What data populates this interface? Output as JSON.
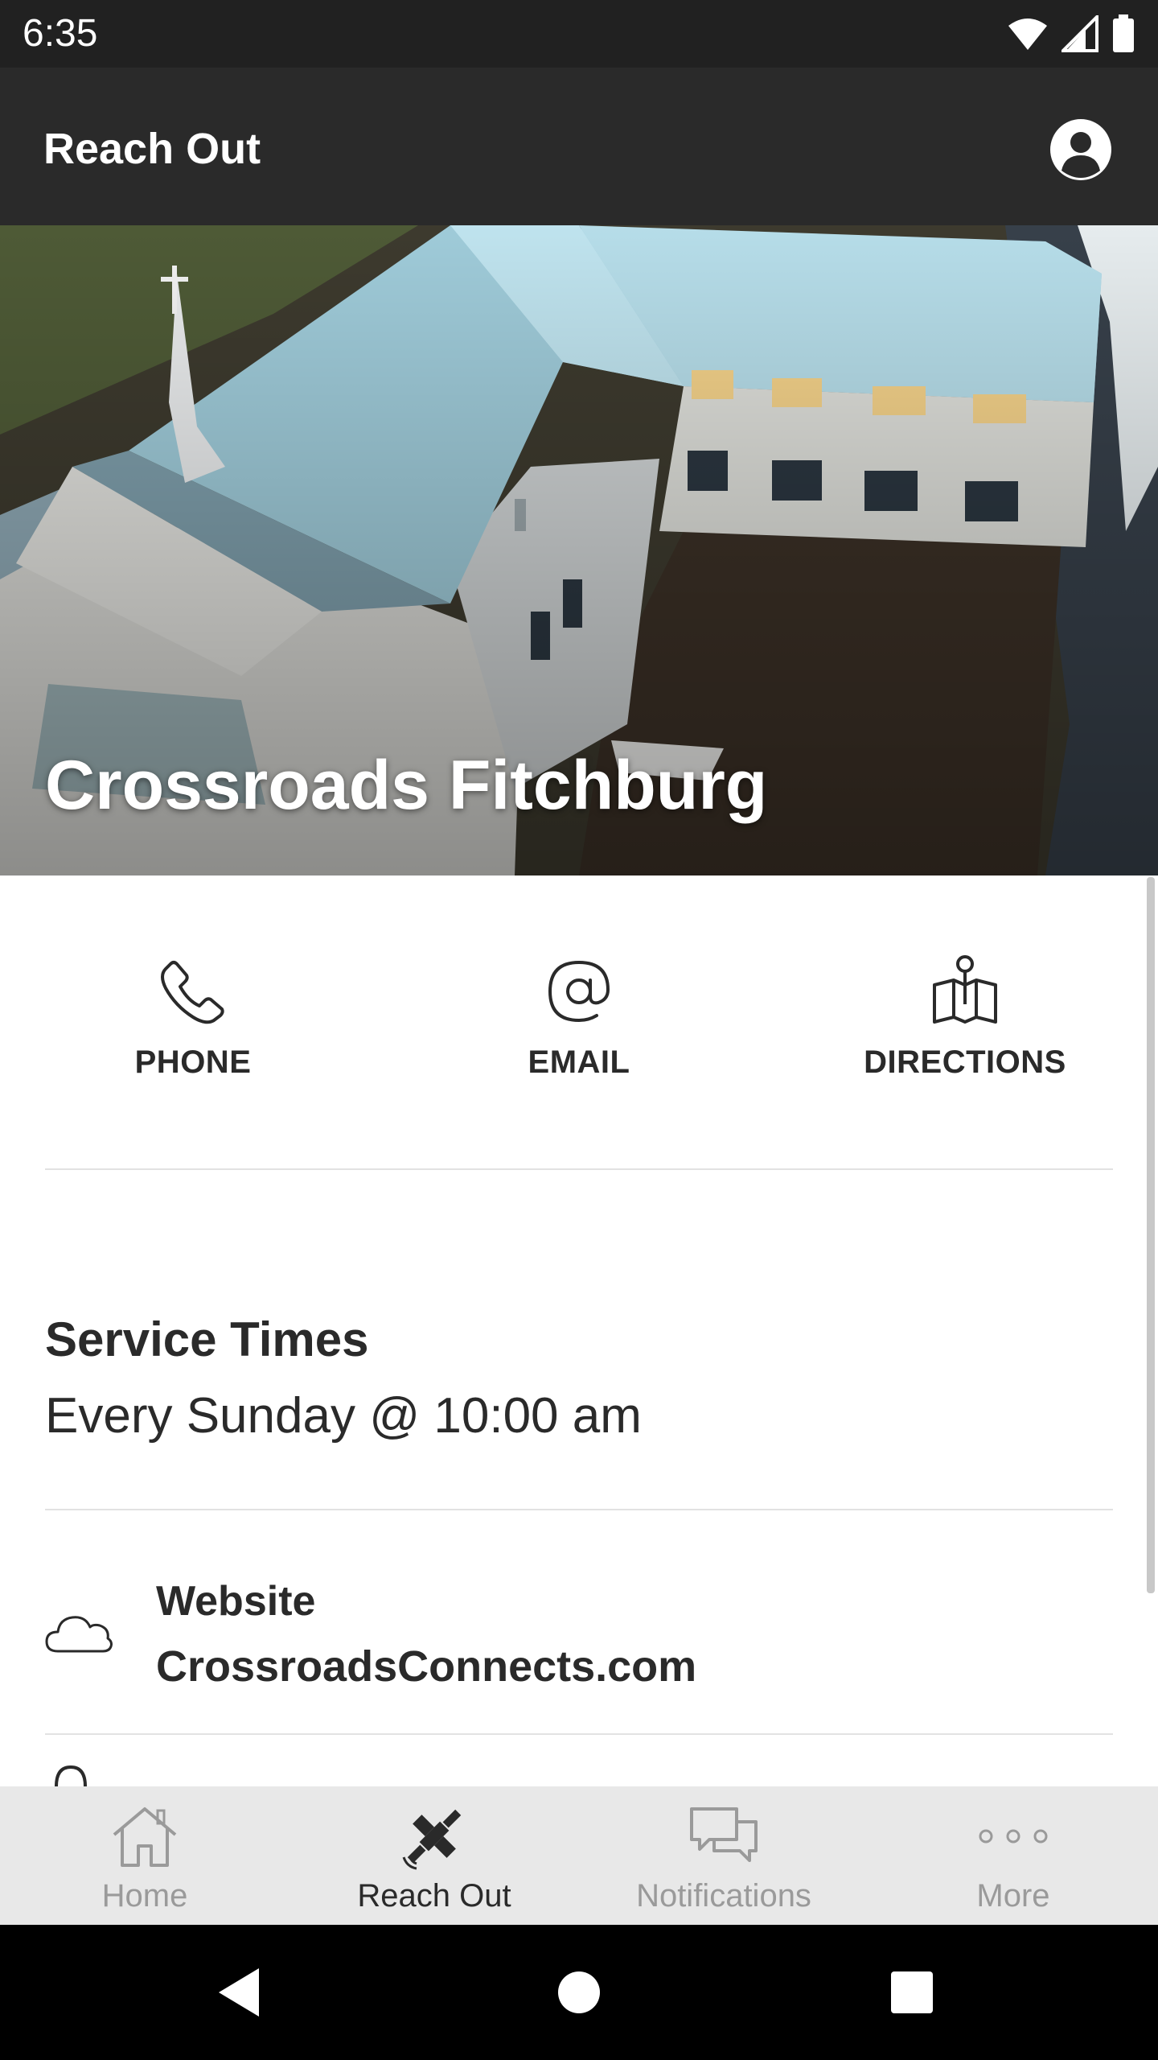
{
  "status_bar": {
    "time": "6:35"
  },
  "app_bar": {
    "title": "Reach Out"
  },
  "hero": {
    "title": "Crossroads Fitchburg"
  },
  "actions": [
    {
      "label": "PHONE",
      "icon": "phone-icon"
    },
    {
      "label": "EMAIL",
      "icon": "at-sign-icon"
    },
    {
      "label": "DIRECTIONS",
      "icon": "map-pin-icon"
    }
  ],
  "service": {
    "heading": "Service Times",
    "value": "Every Sunday @ 10:00 am"
  },
  "website": {
    "label": "Website",
    "value": "CrossroadsConnects.com",
    "icon": "cloud-icon"
  },
  "bottom_nav": {
    "items": [
      {
        "label": "Home",
        "icon": "home-icon"
      },
      {
        "label": "Reach Out",
        "icon": "satellite-icon",
        "active": true
      },
      {
        "label": "Notifications",
        "icon": "chat-bubbles-icon"
      },
      {
        "label": "More",
        "icon": "more-dots-icon"
      }
    ]
  },
  "colors": {
    "app_bar": "#2a2a2a",
    "status_bar": "#212121",
    "bottom_nav_bg": "#e8e8e8",
    "nav_inactive": "#9a9a9a",
    "nav_active": "#2a2a2a"
  }
}
